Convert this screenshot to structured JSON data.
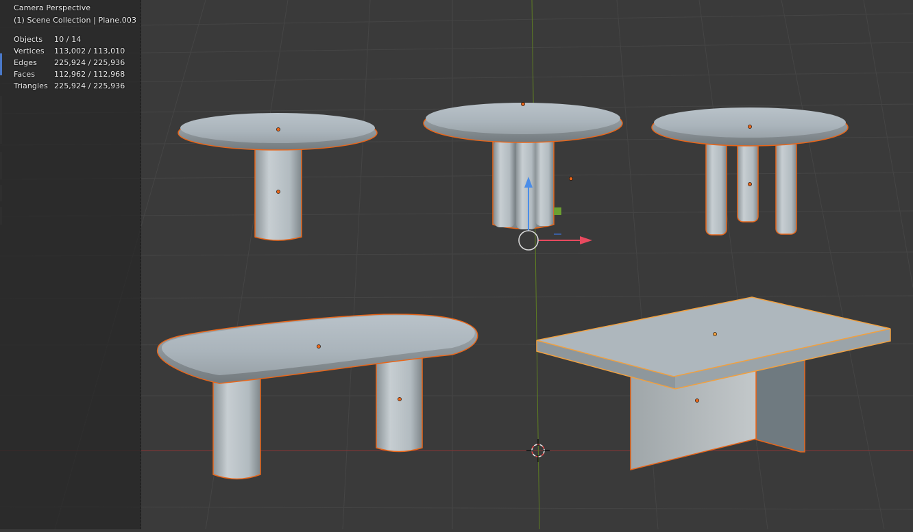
{
  "viewport": {
    "view_name": "Camera Perspective",
    "collection_info": "(1) Scene Collection | Plane.003"
  },
  "statistics": [
    {
      "label": "Objects",
      "value": "10 / 14"
    },
    {
      "label": "Vertices",
      "value": "113,002 / 113,010"
    },
    {
      "label": "Edges",
      "value": "225,924 / 225,936"
    },
    {
      "label": "Faces",
      "value": "112,962 / 112,968"
    },
    {
      "label": "Triangles",
      "value": "225,924 / 225,936"
    }
  ],
  "scene_objects": [
    {
      "name": "round-table-single-pedestal",
      "selected": true
    },
    {
      "name": "round-table-cluster-pedestal",
      "selected": true
    },
    {
      "name": "round-table-three-legs",
      "selected": true
    },
    {
      "name": "organic-oval-table-two-legs",
      "selected": true
    },
    {
      "name": "rectangular-table-panel-legs",
      "selected": true,
      "active": true
    }
  ],
  "colors": {
    "viewport_bg": "#3a3a3a",
    "grid_line": "#444444",
    "selection_outline": "#e8661a",
    "active_outline": "#f0a040",
    "axis_x": "#a83232",
    "axis_y": "#6b8f24",
    "gizmo_x": "#e84a5f",
    "gizmo_z": "#4a8de8",
    "gizmo_plane": "#6ca030",
    "mesh_light": "#c2cdd5",
    "mesh_dark": "#8c9599"
  }
}
